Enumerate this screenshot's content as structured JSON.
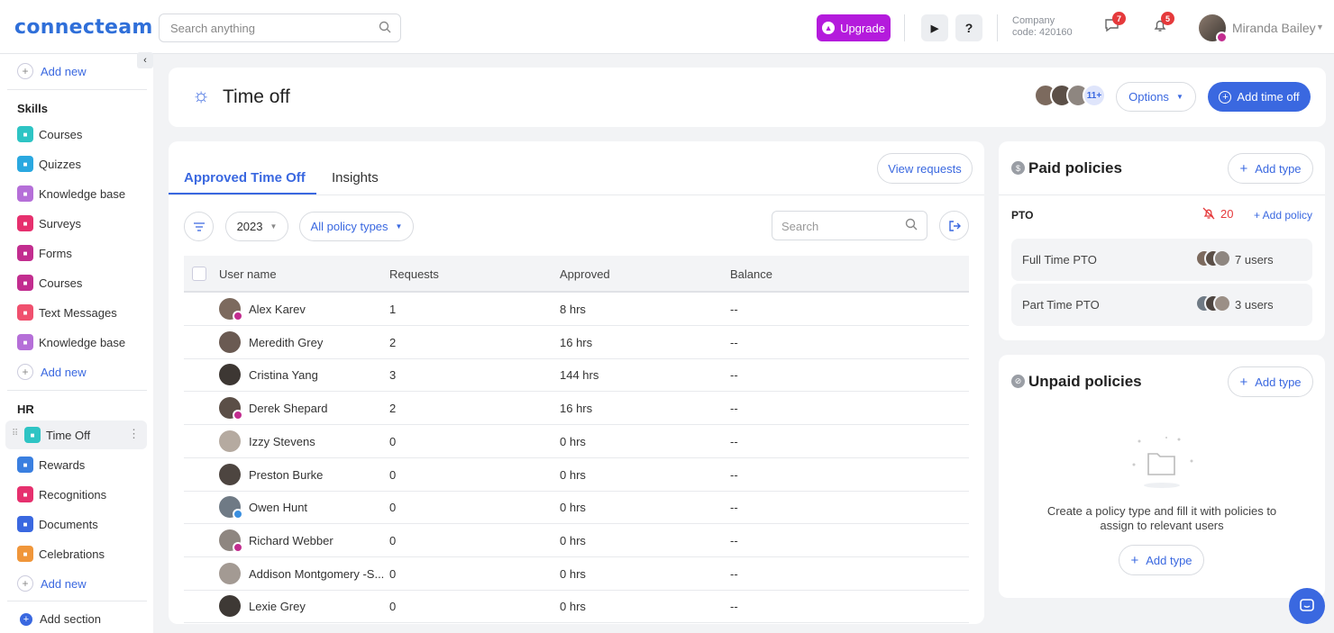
{
  "topbar": {
    "logo": "connecteam",
    "search_placeholder": "Search anything",
    "upgrade_label": "Upgrade",
    "company_line1": "Company",
    "company_line2": "code: 420160",
    "messages_count": "7",
    "notifications_count": "5",
    "user_name": "Miranda Bailey"
  },
  "sidebar": {
    "add_new_top": "Add new",
    "skills_header": "Skills",
    "skills_items": [
      {
        "label": "Courses",
        "color": "#2ec4c4"
      },
      {
        "label": "Quizzes",
        "color": "#2aa8e0"
      },
      {
        "label": "Knowledge base",
        "color": "#b56fd8"
      },
      {
        "label": "Surveys",
        "color": "#e6306e"
      },
      {
        "label": "Forms",
        "color": "#c22d8f"
      },
      {
        "label": "Courses",
        "color": "#c22d8f"
      },
      {
        "label": "Text Messages",
        "color": "#f0506e"
      },
      {
        "label": "Knowledge base",
        "color": "#b56fd8"
      }
    ],
    "add_new_skills": "Add new",
    "hr_header": "HR",
    "hr_items": [
      {
        "label": "Time Off",
        "color": "#2ec4c4"
      },
      {
        "label": "Rewards",
        "color": "#3a7fe0"
      },
      {
        "label": "Recognitions",
        "color": "#e6306e"
      },
      {
        "label": "Documents",
        "color": "#3a68e0"
      },
      {
        "label": "Celebrations",
        "color": "#f0963a"
      }
    ],
    "add_new_hr": "Add new",
    "add_section": "Add section"
  },
  "header": {
    "title": "Time off",
    "avatars_more": "11+",
    "options_label": "Options",
    "add_time_off_label": "Add time off"
  },
  "main": {
    "tabs": [
      "Approved Time Off",
      "Insights"
    ],
    "view_requests": "View requests",
    "year_filter": "2023",
    "policy_filter": "All policy types",
    "search_placeholder": "Search",
    "columns": [
      "User name",
      "Requests",
      "Approved",
      "Balance"
    ],
    "rows": [
      {
        "name": "Alex Karev",
        "requests": "1",
        "approved": "8 hrs",
        "balance": "--",
        "badge": "#c22d8f"
      },
      {
        "name": "Meredith Grey",
        "requests": "2",
        "approved": "16 hrs",
        "balance": "--",
        "badge": ""
      },
      {
        "name": "Cristina Yang",
        "requests": "3",
        "approved": "144 hrs",
        "balance": "--",
        "badge": ""
      },
      {
        "name": "Derek Shepard",
        "requests": "2",
        "approved": "16 hrs",
        "balance": "--",
        "badge": "#c22d8f"
      },
      {
        "name": "Izzy Stevens",
        "requests": "0",
        "approved": "0 hrs",
        "balance": "--",
        "badge": ""
      },
      {
        "name": "Preston Burke",
        "requests": "0",
        "approved": "0 hrs",
        "balance": "--",
        "badge": ""
      },
      {
        "name": "Owen Hunt",
        "requests": "0",
        "approved": "0 hrs",
        "balance": "--",
        "badge": "#3a8fe0"
      },
      {
        "name": "Richard Webber",
        "requests": "0",
        "approved": "0 hrs",
        "balance": "--",
        "badge": "#c22d8f"
      },
      {
        "name": "Addison Montgomery -S...",
        "requests": "0",
        "approved": "0 hrs",
        "balance": "--",
        "badge": ""
      },
      {
        "name": "Lexie Grey",
        "requests": "0",
        "approved": "0 hrs",
        "balance": "--",
        "badge": ""
      }
    ]
  },
  "paid": {
    "title": "Paid policies",
    "add_type": "Add type",
    "pto_label": "PTO",
    "pto_count": "20",
    "add_policy": "+ Add policy",
    "policies": [
      {
        "name": "Full Time PTO",
        "users": "7 users"
      },
      {
        "name": "Part Time PTO",
        "users": "3 users"
      }
    ]
  },
  "unpaid": {
    "title": "Unpaid policies",
    "add_type": "Add type",
    "empty_line1": "Create a policy type and fill it with policies to",
    "empty_line2": "assign to relevant users",
    "add_type_bottom": "Add type"
  }
}
